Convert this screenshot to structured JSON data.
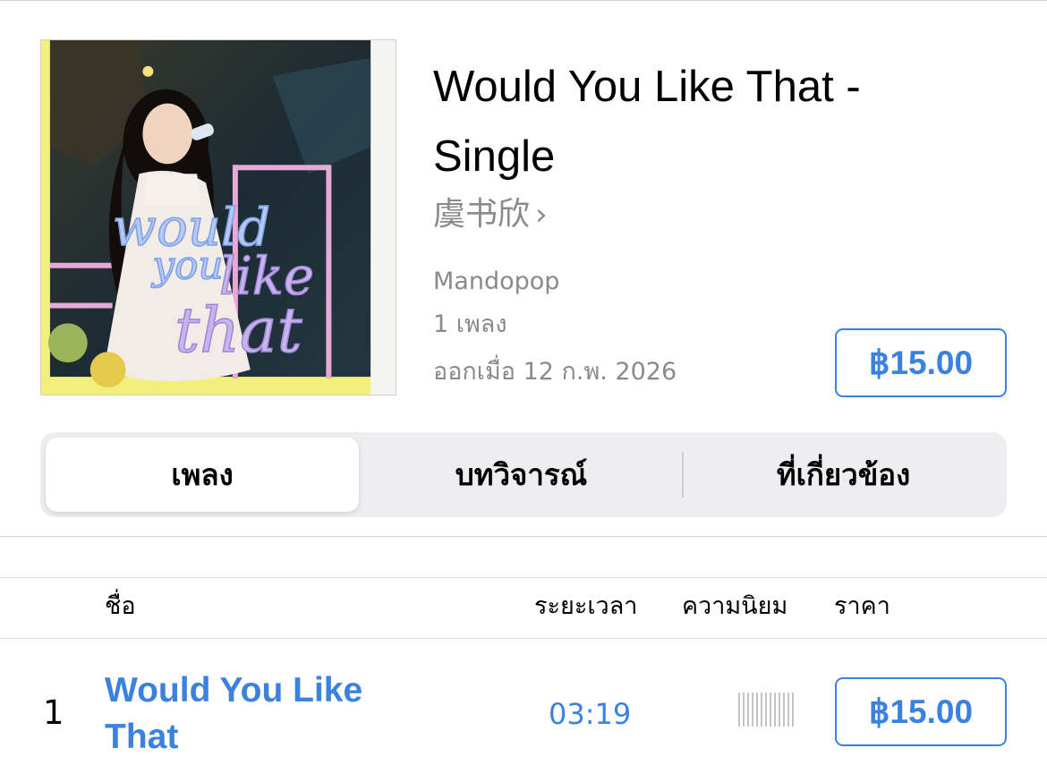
{
  "album": {
    "title": "Would You Like That - Single",
    "artist": "虞书欣",
    "genre": "Mandopop",
    "track_count": "1 เพลง",
    "release": "ออกเมื่อ 12 ก.พ. 2026",
    "price": "฿15.00",
    "art_text": [
      "would",
      "you",
      "like",
      "that"
    ]
  },
  "tabs": [
    {
      "label": "เพลง",
      "selected": true
    },
    {
      "label": "บทวิจารณ์",
      "selected": false
    },
    {
      "label": "ที่เกี่ยวข้อง",
      "selected": false
    }
  ],
  "table": {
    "headers": {
      "name": "ชื่อ",
      "duration": "ระยะเวลา",
      "popularity": "ความนิยม",
      "price": "ราคา"
    },
    "rows": [
      {
        "number": "1",
        "title": "Would You Like That",
        "duration": "03:19",
        "popularity": 0,
        "price": "฿15.00"
      }
    ]
  },
  "colors": {
    "accent": "#3b82e0",
    "secondary_text": "#8a8a8e",
    "segment_bg": "#eeeef0"
  },
  "icons": {
    "artist_link": "chevron-right-icon",
    "popularity": "popularity-bars-icon"
  }
}
